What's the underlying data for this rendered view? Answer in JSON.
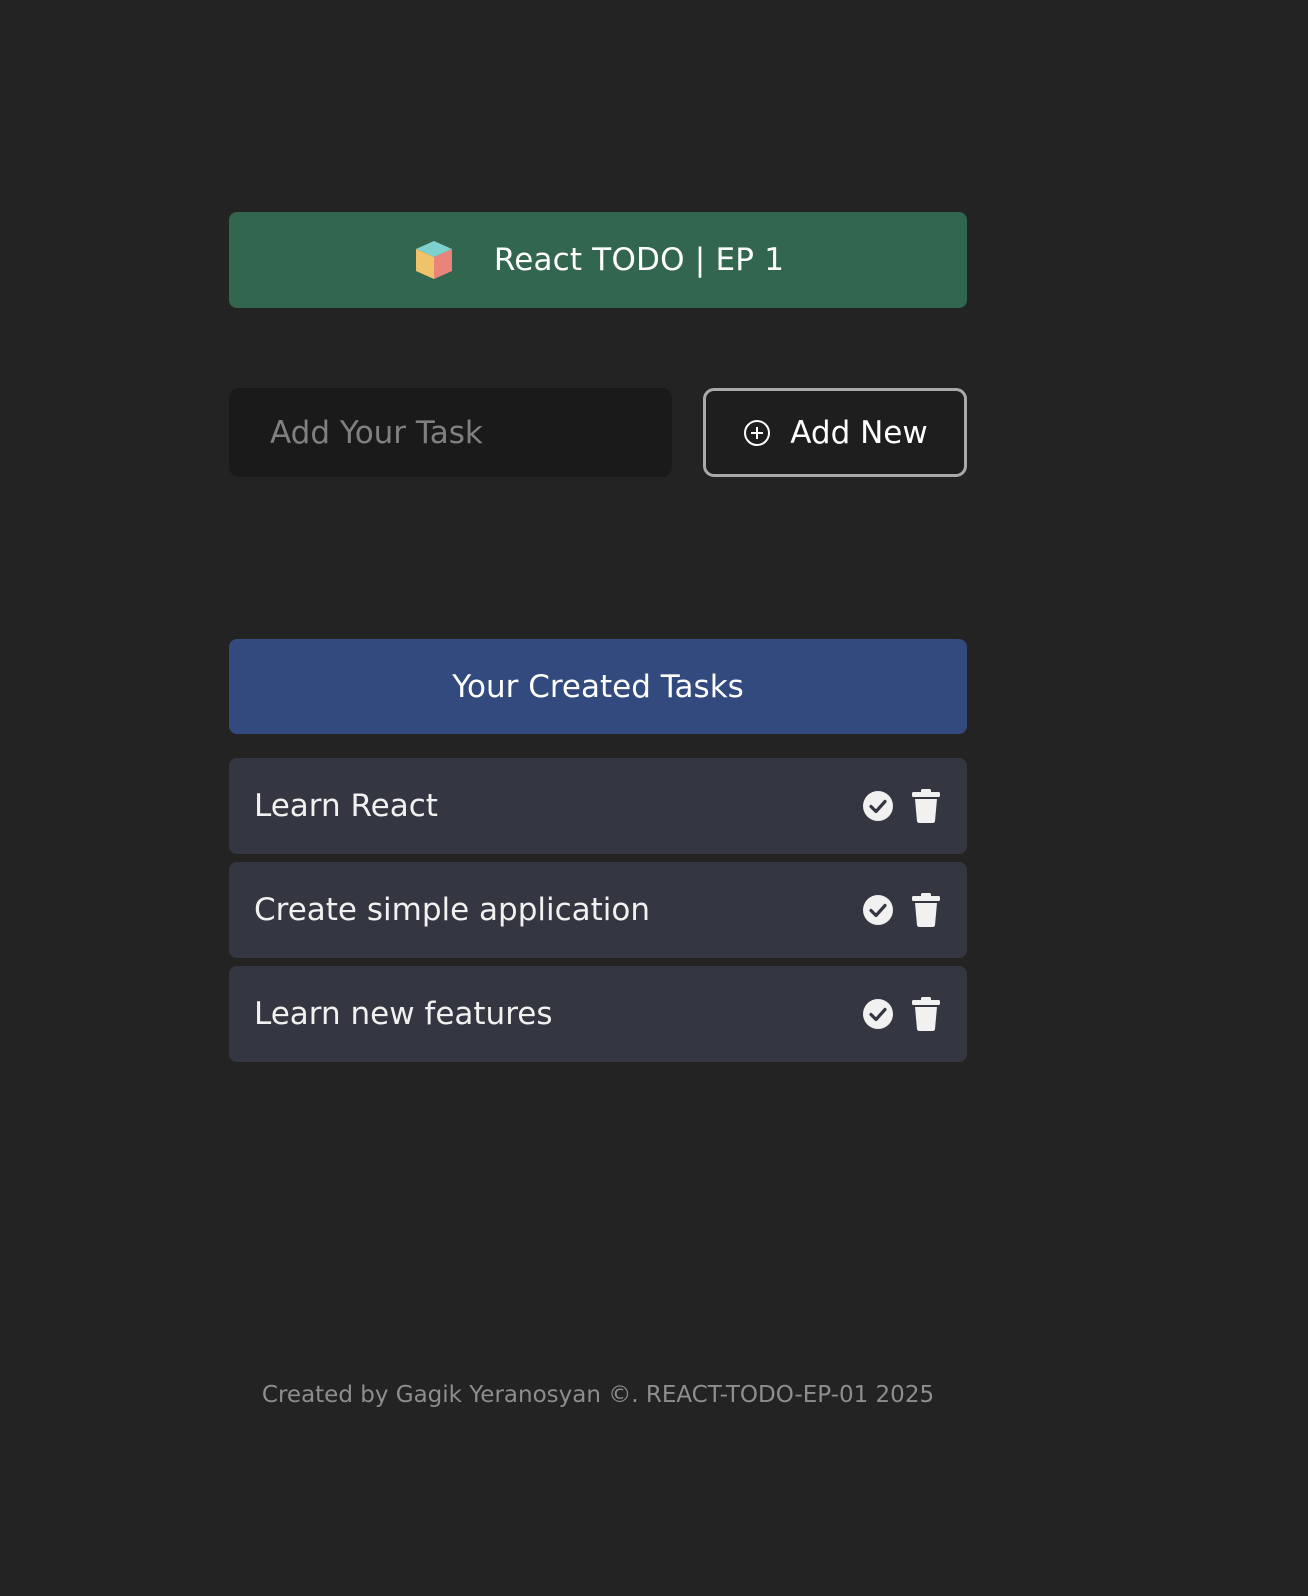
{
  "header": {
    "logo_icon": "cube-logo-icon",
    "title": "React TODO | EP 1",
    "background": "#33664f"
  },
  "form": {
    "input_placeholder": "Add Your Task",
    "input_value": "",
    "add_button_icon": "plus-circle-icon",
    "add_button_label": "Add New"
  },
  "tasks_section": {
    "heading": "Your Created Tasks",
    "heading_background": "#324a7d",
    "items": [
      {
        "label": "Learn React",
        "complete_icon": "check-circle-icon",
        "delete_icon": "trash-icon"
      },
      {
        "label": "Create simple application",
        "complete_icon": "check-circle-icon",
        "delete_icon": "trash-icon"
      },
      {
        "label": "Learn new features",
        "complete_icon": "check-circle-icon",
        "delete_icon": "trash-icon"
      }
    ]
  },
  "footer": {
    "text": "Created by Gagik Yeranosyan ©. REACT-TODO-EP-01 2025"
  }
}
